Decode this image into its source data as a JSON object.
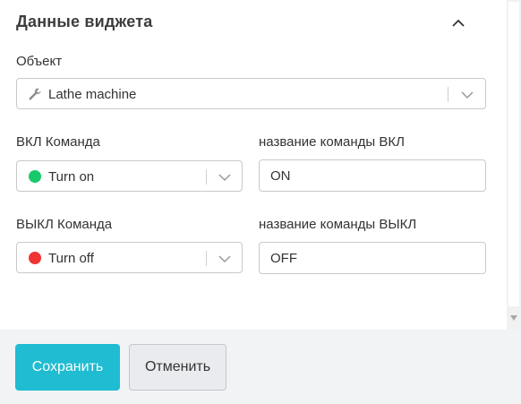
{
  "widget_data": {
    "title": "Данные виджета",
    "object": {
      "label": "Объект",
      "value": "Lathe machine",
      "icon": "wrench-icon"
    },
    "on_command": {
      "label": "ВКЛ Команда",
      "value": "Turn on",
      "status_color": "#18c96a",
      "name_label": "название команды ВКЛ",
      "name_value": "ON"
    },
    "off_command": {
      "label": "ВЫКЛ Команда",
      "value": "Turn off",
      "status_color": "#f03434",
      "name_label": "название команды ВЫКЛ",
      "name_value": "OFF"
    }
  },
  "footer": {
    "save_label": "Сохранить",
    "cancel_label": "Отменить"
  },
  "colors": {
    "primary": "#1fbcd2"
  }
}
